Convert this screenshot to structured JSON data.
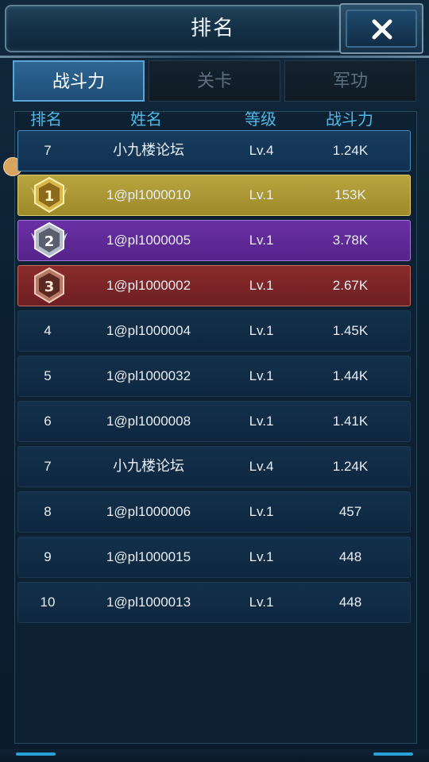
{
  "header": {
    "title": "排名",
    "close_icon": "close-x-icon"
  },
  "tabs": [
    {
      "label": "战斗力",
      "active": true
    },
    {
      "label": "关卡",
      "active": false
    },
    {
      "label": "军功",
      "active": false
    }
  ],
  "columns": {
    "rank": "排名",
    "name": "姓名",
    "level": "等级",
    "power": "战斗力"
  },
  "my_row": {
    "rank": "7",
    "name": "小九楼论坛",
    "level": "Lv.4",
    "power": "1.24K"
  },
  "rows": [
    {
      "rank": "1",
      "medal": "gold-medal-icon",
      "name": "1@pl1000010",
      "level": "Lv.1",
      "power": "153K"
    },
    {
      "rank": "2",
      "medal": "silver-medal-icon",
      "name": "1@pl1000005",
      "level": "Lv.1",
      "power": "3.78K"
    },
    {
      "rank": "3",
      "medal": "bronze-medal-icon",
      "name": "1@pl1000002",
      "level": "Lv.1",
      "power": "2.67K"
    },
    {
      "rank": "4",
      "name": "1@pl1000004",
      "level": "Lv.1",
      "power": "1.45K"
    },
    {
      "rank": "5",
      "name": "1@pl1000032",
      "level": "Lv.1",
      "power": "1.44K"
    },
    {
      "rank": "6",
      "name": "1@pl1000008",
      "level": "Lv.1",
      "power": "1.41K"
    },
    {
      "rank": "7",
      "name": "小九楼论坛",
      "level": "Lv.4",
      "power": "1.24K"
    },
    {
      "rank": "8",
      "name": "1@pl1000006",
      "level": "Lv.1",
      "power": "457"
    },
    {
      "rank": "9",
      "name": "1@pl1000015",
      "level": "Lv.1",
      "power": "448"
    },
    {
      "rank": "10",
      "name": "1@pl1000013",
      "level": "Lv.1",
      "power": "448"
    }
  ],
  "colors": {
    "accent": "#4eb8e6",
    "gold": "#b9a53e",
    "silver": "#6a2fa5",
    "bronze": "#8a2b2b"
  }
}
